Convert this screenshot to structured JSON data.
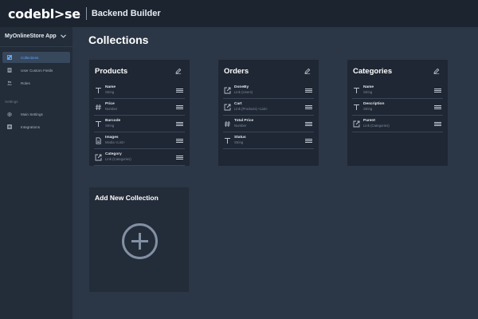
{
  "header": {
    "logo": "codebl>se",
    "product": "Backend Builder"
  },
  "sidebar": {
    "app_name": "MyOnlineStore App",
    "items": [
      {
        "label": "Collections",
        "icon": "collections-icon",
        "active": true
      },
      {
        "label": "User Custom Fields",
        "icon": "user-fields-icon",
        "active": false
      },
      {
        "label": "Roles",
        "icon": "roles-icon",
        "active": false
      }
    ],
    "settings_label": "Settings",
    "settings_items": [
      {
        "label": "Main Settings",
        "icon": "gear-icon"
      },
      {
        "label": "Integrations",
        "icon": "integrations-icon"
      }
    ]
  },
  "main": {
    "title": "Collections",
    "collections": [
      {
        "title": "Products",
        "fields": [
          {
            "name": "Name",
            "type": "String",
            "icon": "text-icon"
          },
          {
            "name": "Price",
            "type": "Number",
            "icon": "hash-icon"
          },
          {
            "name": "Barcode",
            "type": "String",
            "icon": "text-icon"
          },
          {
            "name": "Images",
            "type": "Media <List>",
            "icon": "file-icon"
          },
          {
            "name": "Category",
            "type": "Link (Categories)",
            "icon": "link-icon"
          }
        ]
      },
      {
        "title": "Orders",
        "fields": [
          {
            "name": "DoneBy",
            "type": "Link (Users)",
            "icon": "link-icon"
          },
          {
            "name": "Cart",
            "type": "Link (Products) <List>",
            "icon": "link-icon"
          },
          {
            "name": "Total Price",
            "type": "Number",
            "icon": "hash-icon"
          },
          {
            "name": "Status",
            "type": "String",
            "icon": "text-icon"
          }
        ]
      },
      {
        "title": "Categories",
        "fields": [
          {
            "name": "Name",
            "type": "String",
            "icon": "text-icon"
          },
          {
            "name": "Description",
            "type": "String",
            "icon": "text-icon"
          },
          {
            "name": "Parent",
            "type": "Link (Categories)",
            "icon": "link-icon"
          }
        ]
      }
    ],
    "add_collection_label": "Add New Collection"
  },
  "colors": {
    "accent": "#5fa3ff",
    "background": "#2b3646",
    "card": "#1f2734",
    "sidebar": "#232c39"
  }
}
